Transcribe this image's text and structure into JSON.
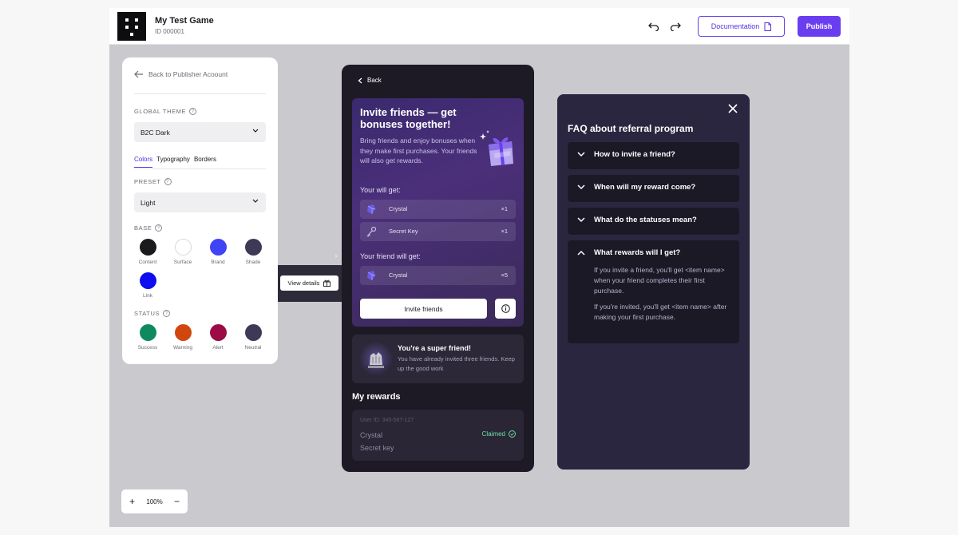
{
  "header": {
    "game_title": "My Test Game",
    "game_id": "ID 000001",
    "documentation_label": "Documentation",
    "publish_label": "Publish"
  },
  "panel": {
    "back_label": "Back to Publisher Acoount",
    "global_theme_label": "GLOBAL THEME",
    "global_theme_value": "B2C Dark",
    "tabs": [
      "Colors",
      "Typography",
      "Borders"
    ],
    "preset_label": "PRESET",
    "preset_value": "Light",
    "base_label": "BASE",
    "base_swatches": [
      {
        "label": "Content",
        "color": "#1a1a1d"
      },
      {
        "label": "Surface",
        "color": "#ffffff"
      },
      {
        "label": "Brand",
        "color": "#3f44f5"
      },
      {
        "label": "Shade",
        "color": "#3f3958"
      },
      {
        "label": "Link",
        "color": "#0d0df0"
      }
    ],
    "status_label": "STATUS",
    "status_swatches": [
      {
        "label": "Success",
        "color": "#0f8a5f"
      },
      {
        "label": "Warning",
        "color": "#d1460c"
      },
      {
        "label": "Alert",
        "color": "#9b0b46"
      },
      {
        "label": "Neutral",
        "color": "#3f3958"
      }
    ]
  },
  "view_details_label": "View details",
  "phone": {
    "back_label": "Back",
    "invite_title": "Invite friends — get bonuses together!",
    "invite_desc": "Bring friends and enjoy bonuses when they make first purchases. Your friends will also get rewards.",
    "you_get_label": "Your will get:",
    "you_get": [
      {
        "name": "Crystal",
        "qty": "×1"
      },
      {
        "name": "Secret Key",
        "qty": "×1"
      }
    ],
    "friend_get_label": "Your friend will get:",
    "friend_get": [
      {
        "name": "Crystal",
        "qty": "×5"
      }
    ],
    "invite_button": "Invite friends",
    "super_title": "You're a super friend!",
    "super_desc": "You have already invited three friends. Keep up the good work",
    "my_rewards": "My rewards",
    "history_user": "User ID: 345-567-127",
    "history_items": [
      "Crystal",
      "Secret key"
    ],
    "claimed_label": "Claimed"
  },
  "faq": {
    "title": "FAQ about referral program",
    "items": [
      {
        "q": "How to invite a friend?"
      },
      {
        "q": "When will my reward come?"
      },
      {
        "q": "What do the statuses mean?"
      },
      {
        "q": "What rewards will I get?",
        "a1": "If you invite a friend, you'll get <item name> when your friend completes their first purchase.",
        "a2": "If you're invited, you'll get <item name> after making your first purchase."
      }
    ]
  },
  "zoom": {
    "level": "100%"
  }
}
